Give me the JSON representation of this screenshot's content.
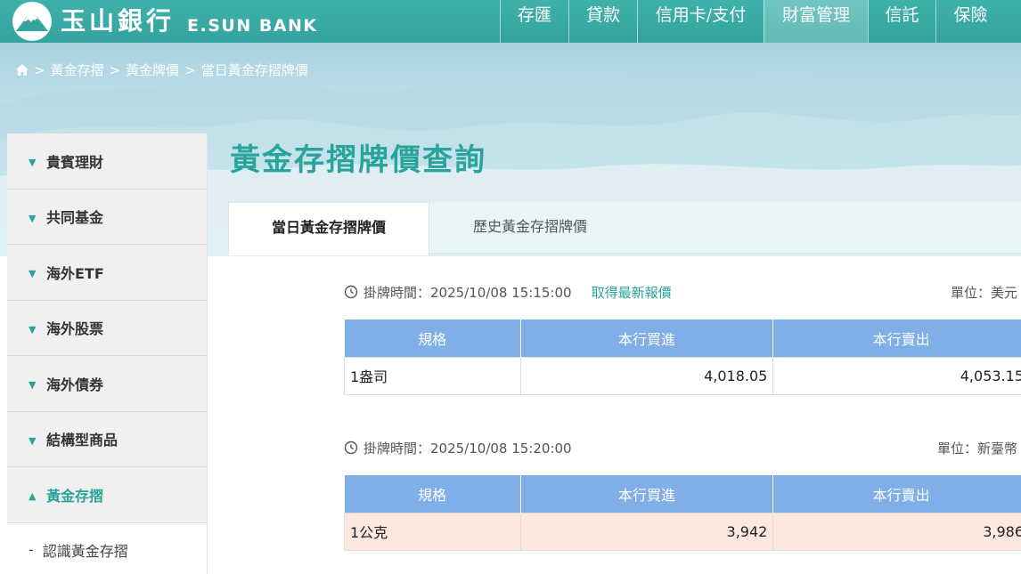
{
  "brand": {
    "name_cn": "玉山銀行",
    "name_en": "E.SUN BANK"
  },
  "topnav": {
    "items": [
      {
        "label": "存匯",
        "active": false
      },
      {
        "label": "貸款",
        "active": false
      },
      {
        "label": "信用卡/支付",
        "active": false
      },
      {
        "label": "財富管理",
        "active": true
      },
      {
        "label": "信託",
        "active": false
      },
      {
        "label": "保險",
        "active": false
      }
    ]
  },
  "breadcrumb": {
    "home_icon": "home-icon",
    "items": [
      "黃金存摺",
      "黃金牌價",
      "當日黃金存摺牌價"
    ],
    "separator": ">"
  },
  "sidebar": {
    "items": [
      {
        "label": "貴賓理財",
        "expanded": false
      },
      {
        "label": "共同基金",
        "expanded": false
      },
      {
        "label": "海外ETF",
        "expanded": false
      },
      {
        "label": "海外股票",
        "expanded": false
      },
      {
        "label": "海外債券",
        "expanded": false
      },
      {
        "label": "結構型商品",
        "expanded": false
      },
      {
        "label": "黃金存摺",
        "expanded": true
      }
    ],
    "subitems": [
      {
        "label": "認識黃金存摺"
      }
    ]
  },
  "main": {
    "title": "黃金存摺牌價查詢",
    "tabs": [
      {
        "label": "當日黃金存摺牌價",
        "active": true
      },
      {
        "label": "歷史黃金存摺牌價",
        "active": false
      }
    ],
    "usd_block": {
      "time_label": "掛牌時間：2025/10/08 15:15:00",
      "refresh_link": "取得最新報價",
      "unit": "單位：美元",
      "headers": [
        "規格",
        "本行買進",
        "本行賣出"
      ],
      "rows": [
        {
          "spec": "1盎司",
          "buy": "4,018.05",
          "sell": "4,053.15"
        }
      ]
    },
    "twd_block": {
      "time_label": "掛牌時間：2025/10/08 15:20:00",
      "unit": "單位：新臺幣",
      "headers": [
        "規格",
        "本行買進",
        "本行賣出"
      ],
      "rows": [
        {
          "spec": "1公克",
          "buy": "3,942",
          "sell": "3,986"
        }
      ]
    }
  },
  "colors": {
    "brand_teal": "#33a39d",
    "title_teal": "#2aa39c",
    "table_header_blue": "#7faee8",
    "highlight_row": "#fce8de"
  }
}
